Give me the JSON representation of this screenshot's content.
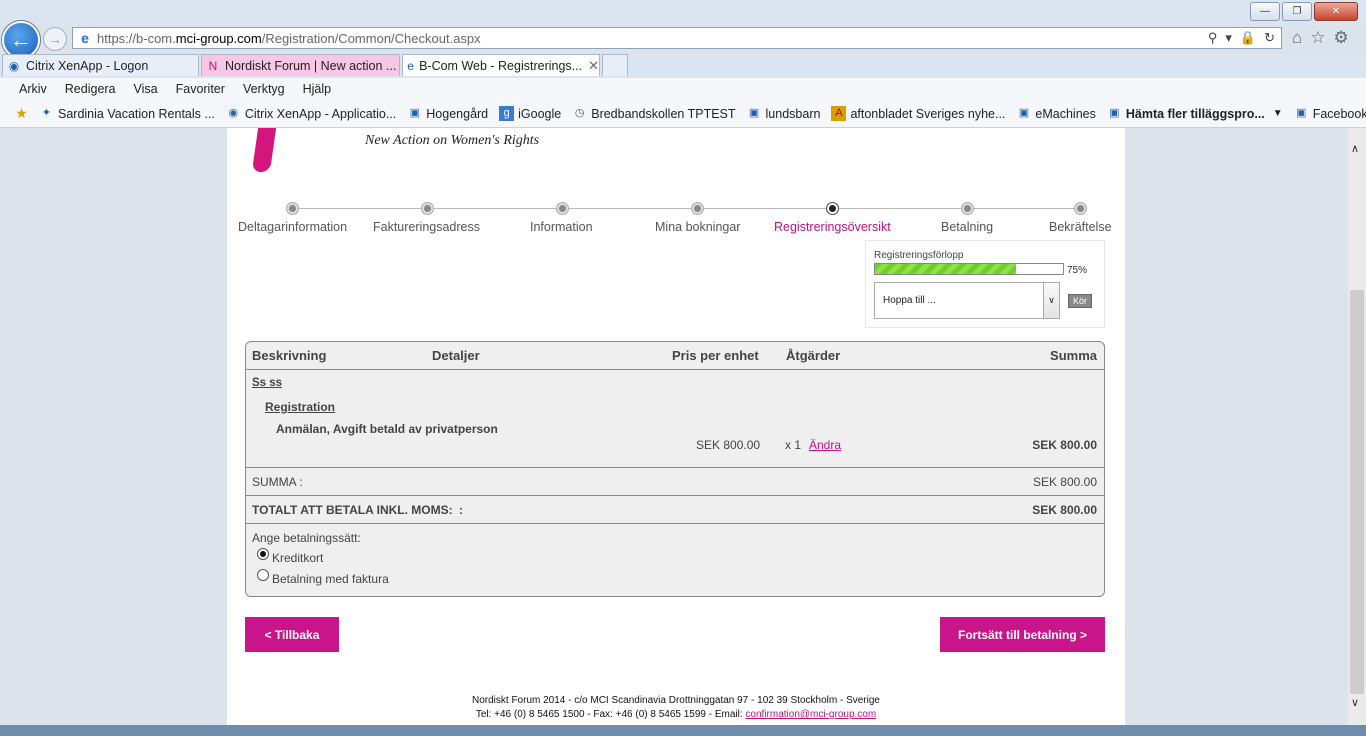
{
  "browser": {
    "url_prefix": "https://b-com.",
    "url_domain": "mci-group.com",
    "url_path": "/Registration/Common/Checkout.aspx",
    "tabs": [
      {
        "label": "Citrix XenApp - Logon",
        "icon": "citrix-icon"
      },
      {
        "label": "Nordiskt Forum | New action ...",
        "icon": "nordiskt-icon"
      },
      {
        "label": "B-Com Web - Registrerings...",
        "icon": "ie-icon"
      }
    ],
    "menu": [
      "Arkiv",
      "Redigera",
      "Visa",
      "Favoriter",
      "Verktyg",
      "Hjälp"
    ],
    "favorites": [
      "Sardinia Vacation Rentals ...",
      "Citrix XenApp - Applicatio...",
      "Hogengård",
      "iGoogle",
      "Bredbandskollen TPTEST",
      "lundsbarn",
      "aftonbladet Sveriges nyhe...",
      "eMachines",
      "Hämta fler tilläggspro...",
      "Facebook"
    ]
  },
  "header": {
    "tagline": "New Action on Women's Rights"
  },
  "steps": [
    {
      "label": "Deltagarinformation",
      "current": false
    },
    {
      "label": "Faktureringsadress",
      "current": false
    },
    {
      "label": "Information",
      "current": false
    },
    {
      "label": "Mina bokningar",
      "current": false
    },
    {
      "label": "Registreringsöversikt",
      "current": true
    },
    {
      "label": "Betalning",
      "current": false
    },
    {
      "label": "Bekräftelse",
      "current": false
    }
  ],
  "progress": {
    "label": "Registreringsförlopp",
    "value": 0.75,
    "percent_text": "75%",
    "jump_placeholder": "Hoppa till ...",
    "go_label": "Kör"
  },
  "table": {
    "headers": {
      "description": "Beskrivning",
      "details": "Detaljer",
      "unit_price": "Pris per enhet",
      "actions": "Åtgärder",
      "total": "Summa"
    },
    "group": "Ss ss",
    "category": "Registration",
    "item": {
      "name": "Anmälan, Avgift betald av privatperson",
      "unit_price": "SEK 800.00",
      "qty": "x 1",
      "edit_label": "Ändra",
      "total": "SEK 800.00"
    },
    "sum_label": "SUMMA :",
    "sum_value": "SEK 800.00",
    "grand_label": "TOTALT ATT BETALA INKL. MOMS:",
    "grand_colon": ":",
    "grand_value": "SEK 800.00",
    "payment_prompt": "Ange betalningssätt:",
    "payment_options": [
      {
        "label": "Kreditkort",
        "selected": true
      },
      {
        "label": "Betalning med faktura",
        "selected": false
      }
    ]
  },
  "buttons": {
    "back": "< Tillbaka",
    "continue": "Fortsätt till betalning >"
  },
  "footer": {
    "line1": "Nordiskt Forum 2014 - c/o MCI Scandinavia Drottninggatan 97 - 102 39 Stockholm - Sverige",
    "line2_prefix": "Tel: +46 (0) 8 5465 1500 - Fax: +46 (0) 8 5465 1599 - Email:",
    "email": "confirmation@mci-group.com"
  },
  "colors": {
    "accent": "#c8158a",
    "progress": "#6fcf2a"
  }
}
